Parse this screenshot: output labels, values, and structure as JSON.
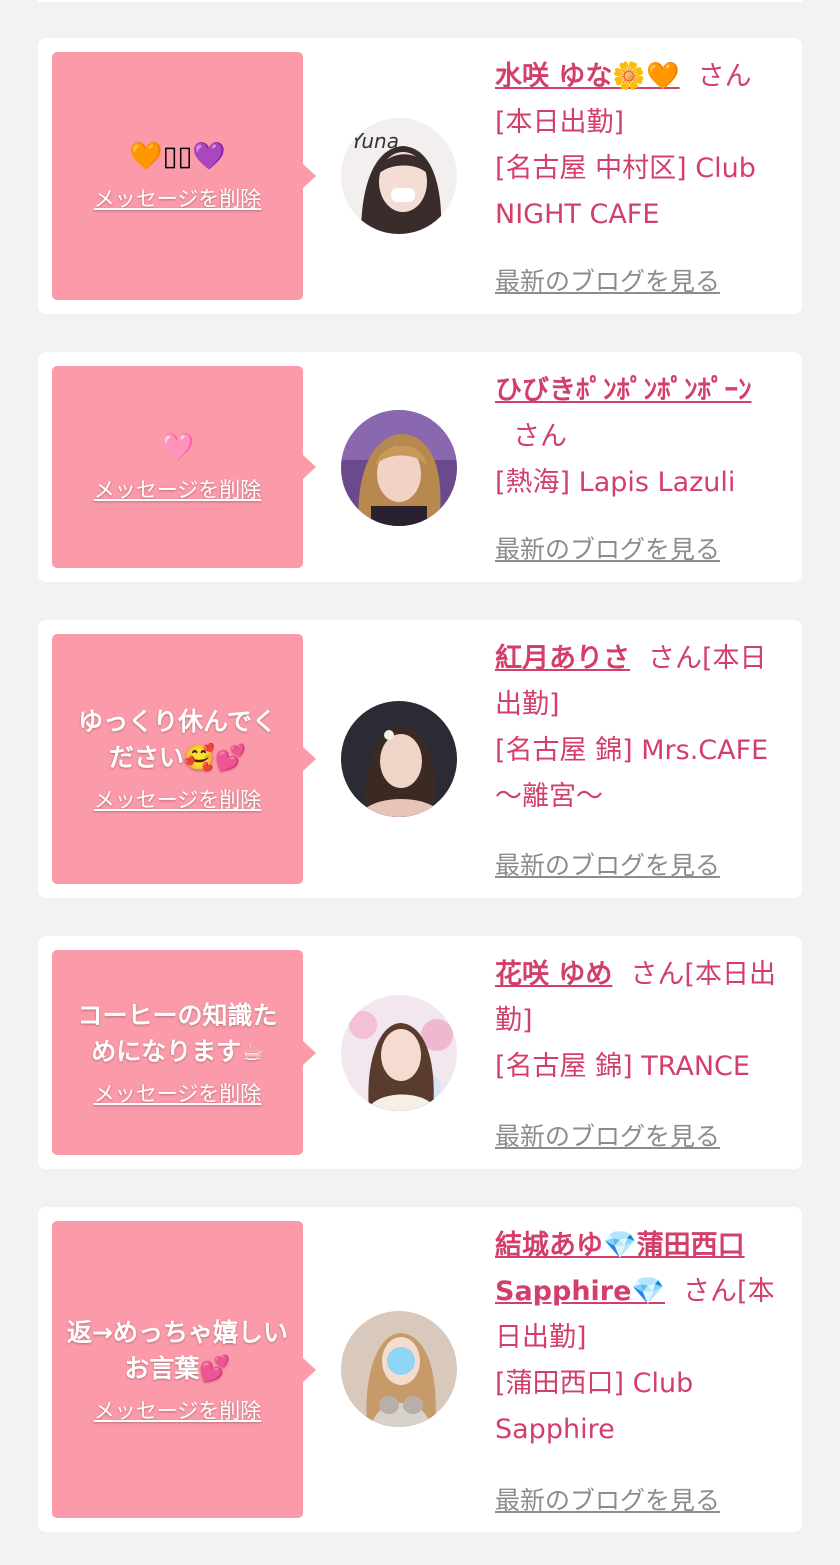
{
  "delete_label": "メッセージを削除",
  "blog_label": "最新のブログを見る",
  "san_label": "さん",
  "colors": {
    "accent": "#d23f6a",
    "bubble": "#fb9aa8",
    "background": "#f2f2f2",
    "blog_link": "#8c8c8c"
  },
  "cards": [
    {
      "message": "",
      "message_emoji": "🧡▯▯💜",
      "name": "水咲 ゆな🌼🧡",
      "status": "[本日出勤]",
      "area": "[名古屋 中村区] Club NIGHT CAFE",
      "avatar_caption": "Yuna"
    },
    {
      "message": "",
      "message_emoji": "🩷",
      "name": "ひびきﾎﾟﾝﾎﾟﾝﾎﾟﾝﾎﾟｰﾝ",
      "status": "",
      "area": "[熱海] Lapis Lazuli"
    },
    {
      "message": "ゆっくり休んでください🥰💕",
      "message_emoji": "",
      "name": "紅月ありさ",
      "status": "[本日出勤]",
      "area": "[名古屋 錦] Mrs.CAFE ～離宮～"
    },
    {
      "message": "コーヒーの知識ためになります☕",
      "message_emoji": "",
      "name": "花咲 ゆめ",
      "status": "[本日出勤]",
      "area": "[名古屋 錦] TRANCE"
    },
    {
      "message": "返→めっちゃ嬉しいお言葉💕",
      "message_emoji": "",
      "name": "結城あゆ💎蒲田西口Sapphire💎",
      "status": "[本日出勤]",
      "area": "[蒲田西口] Club Sapphire"
    }
  ]
}
